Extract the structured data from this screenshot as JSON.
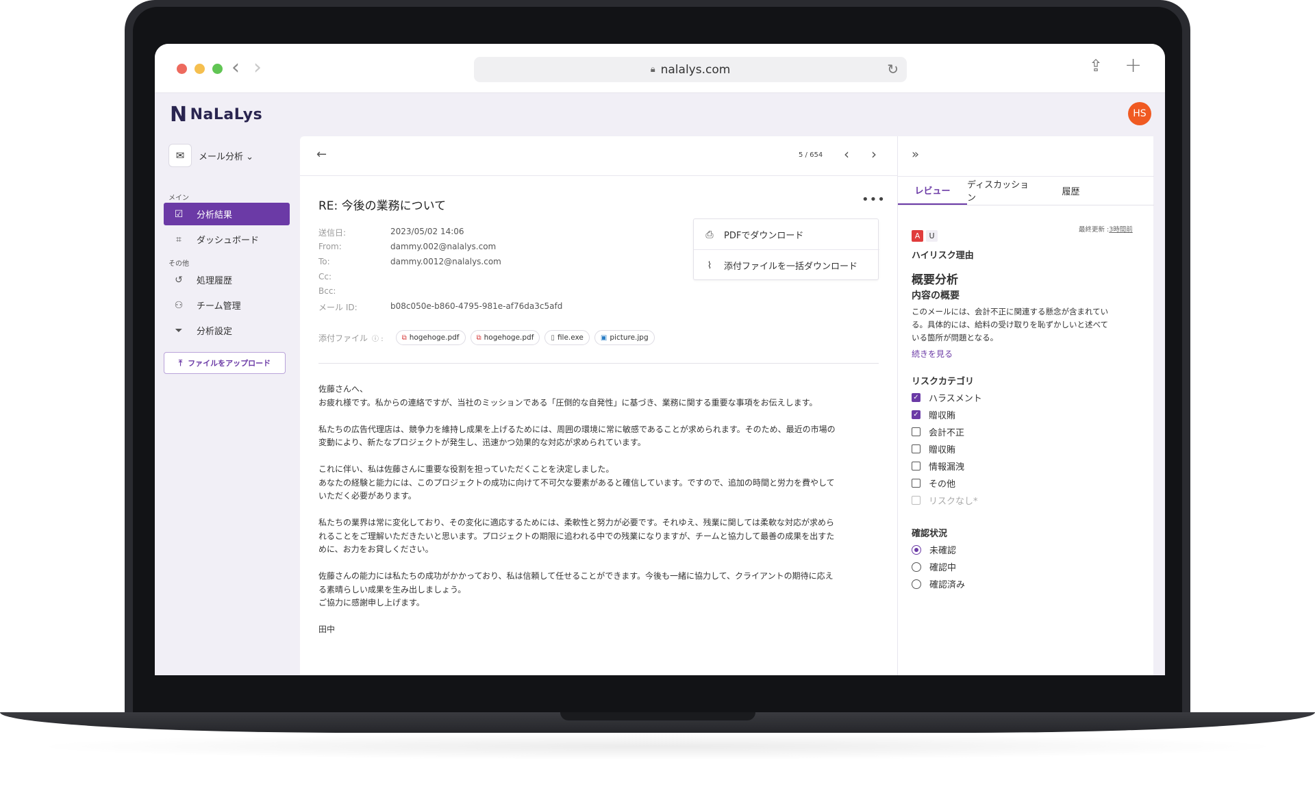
{
  "browser": {
    "url": "nalalys.com",
    "back_icon": "chevron-left-icon",
    "forward_icon": "chevron-right-icon"
  },
  "app": {
    "logo_text": "NaLaLys",
    "avatar_initials": "HS",
    "brand_color": "#6b3aa6",
    "avatar_color": "#f05a22"
  },
  "sidebar": {
    "module": "メール分析",
    "section_main": "メイン",
    "section_other": "その他",
    "items": [
      {
        "label": "分析結果",
        "icon": "check-square-icon",
        "active": true
      },
      {
        "label": "ダッシュボード",
        "icon": "chart-icon",
        "active": false
      },
      {
        "label": "処理履歴",
        "icon": "history-icon",
        "active": false
      },
      {
        "label": "チーム管理",
        "icon": "team-icon",
        "active": false
      },
      {
        "label": "分析設定",
        "icon": "filter-icon",
        "active": false
      }
    ],
    "upload_label": "ファイルをアップロード"
  },
  "mail": {
    "pager": "5 / 654",
    "subject": "RE: 今後の業務について",
    "meta": {
      "sent_label": "送信日:",
      "sent_value": "2023/05/02 14:06",
      "from_label": "From:",
      "from_value": "dammy.002@nalalys.com",
      "to_label": "To:",
      "to_value": "dammy.0012@nalalys.com",
      "cc_label": "Cc:",
      "bcc_label": "Bcc:",
      "id_label": "メール ID:",
      "id_value": "b08c050e-b860-4795-981e-af76da3c5afd",
      "attach_label": "添付ファイル"
    },
    "attachments": [
      {
        "name": "hogehoge.pdf",
        "type": "pdf"
      },
      {
        "name": "hogehoge.pdf",
        "type": "pdf"
      },
      {
        "name": "file.exe",
        "type": "file"
      },
      {
        "name": "picture.jpg",
        "type": "img"
      }
    ],
    "download_menu": {
      "pdf": "PDFでダウンロード",
      "attachments": "添付ファイルを一括ダウンロード"
    },
    "body": [
      "佐藤さんへ、\nお疲れ様です。私からの連絡ですが、当社のミッションである「圧倒的な自発性」に基づき、業務に関する重要な事項をお伝えします。",
      "私たちの広告代理店は、競争力を維持し成果を上げるためには、周囲の環境に常に敏感であることが求められます。そのため、最近の市場の\n変動により、新たなプロジェクトが発生し、迅速かつ効果的な対応が求められています。",
      "これに伴い、私は佐藤さんに重要な役割を担っていただくことを決定しました。\nあなたの経験と能力には、このプロジェクトの成功に向けて不可欠な要素があると確信しています。ですので、追加の時間と労力を費やして\nいただく必要があります。",
      "私たちの業界は常に変化しており、その変化に適応するためには、柔軟性と努力が必要です。それゆえ、残業に関しては柔軟な対応が求めら\nれることをご理解いただきたいと思います。プロジェクトの期限に追われる中での残業になりますが、チームと協力して最善の成果を出すた\nめに、お力をお貸しください。",
      "佐藤さんの能力には私たちの成功がかかっており、私は信頼して任せることができます。今後も一緒に協力して、クライアントの期待に応え\nる素晴らしい成果を生み出しましょう。\nご協力に感謝申し上げます。",
      "田中"
    ]
  },
  "review": {
    "tabs": [
      "レビュー",
      "ディスカッション",
      "履歴"
    ],
    "updated_label": "最終更新 :",
    "updated_value": "3時間前",
    "badge_a": "A",
    "badge_u": "U",
    "high_risk": "ハイリスク理由",
    "summary_title": "概要分析",
    "content_title": "内容の概要",
    "content_text": "このメールには、会計不正に関連する懸念が含まれてい\nる。具体的には、給料の受け取りを恥ずかしいと述べて\nいる箇所が問題となる。",
    "read_more": "続きを見る",
    "risk_title": "リスクカテゴリ",
    "risk_items": [
      {
        "label": "ハラスメント",
        "checked": true
      },
      {
        "label": "贈収賄",
        "checked": true
      },
      {
        "label": "会計不正",
        "checked": false
      },
      {
        "label": "贈収賄",
        "checked": false
      },
      {
        "label": "情報漏洩",
        "checked": false
      },
      {
        "label": "その他",
        "checked": false
      },
      {
        "label": "リスクなし*",
        "checked": false
      }
    ],
    "confirm_title": "確認状況",
    "confirm_items": [
      {
        "label": "未確認",
        "selected": true
      },
      {
        "label": "確認中",
        "selected": false
      },
      {
        "label": "確認済み",
        "selected": false
      }
    ]
  }
}
